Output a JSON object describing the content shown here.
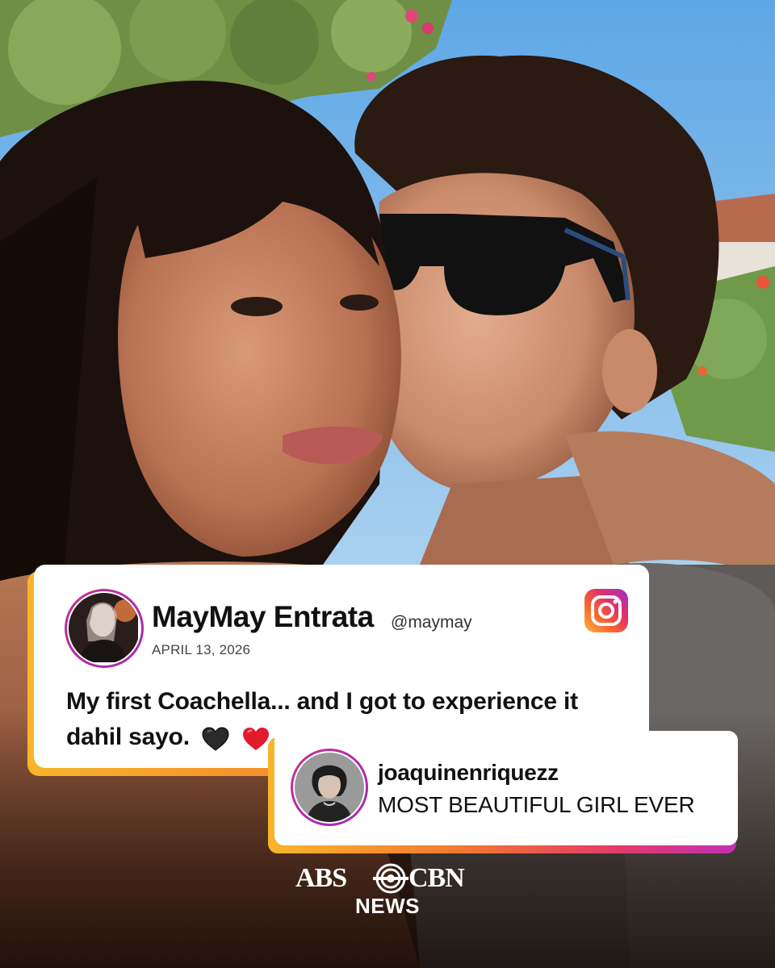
{
  "post": {
    "name": "MayMay Entrata",
    "handle": "@maymay",
    "date": "APRIL 13, 2026",
    "text": "My first Coachella... and I got to experience it dahil sayo.",
    "platform_icon": "instagram-icon",
    "emojis": [
      "black-heart",
      "red-heart"
    ]
  },
  "comment": {
    "user": "joaquinenriquezz",
    "text": "MOST BEAUTIFUL GIRL EVER"
  },
  "logo": {
    "left": "ABS",
    "right": "CBN",
    "sub": "NEWS"
  },
  "colors": {
    "accent_orange": "#f58a2a",
    "accent_yellow": "#f7b52b",
    "accent_magenta": "#c22fb4",
    "card_bg": "#ffffff"
  }
}
